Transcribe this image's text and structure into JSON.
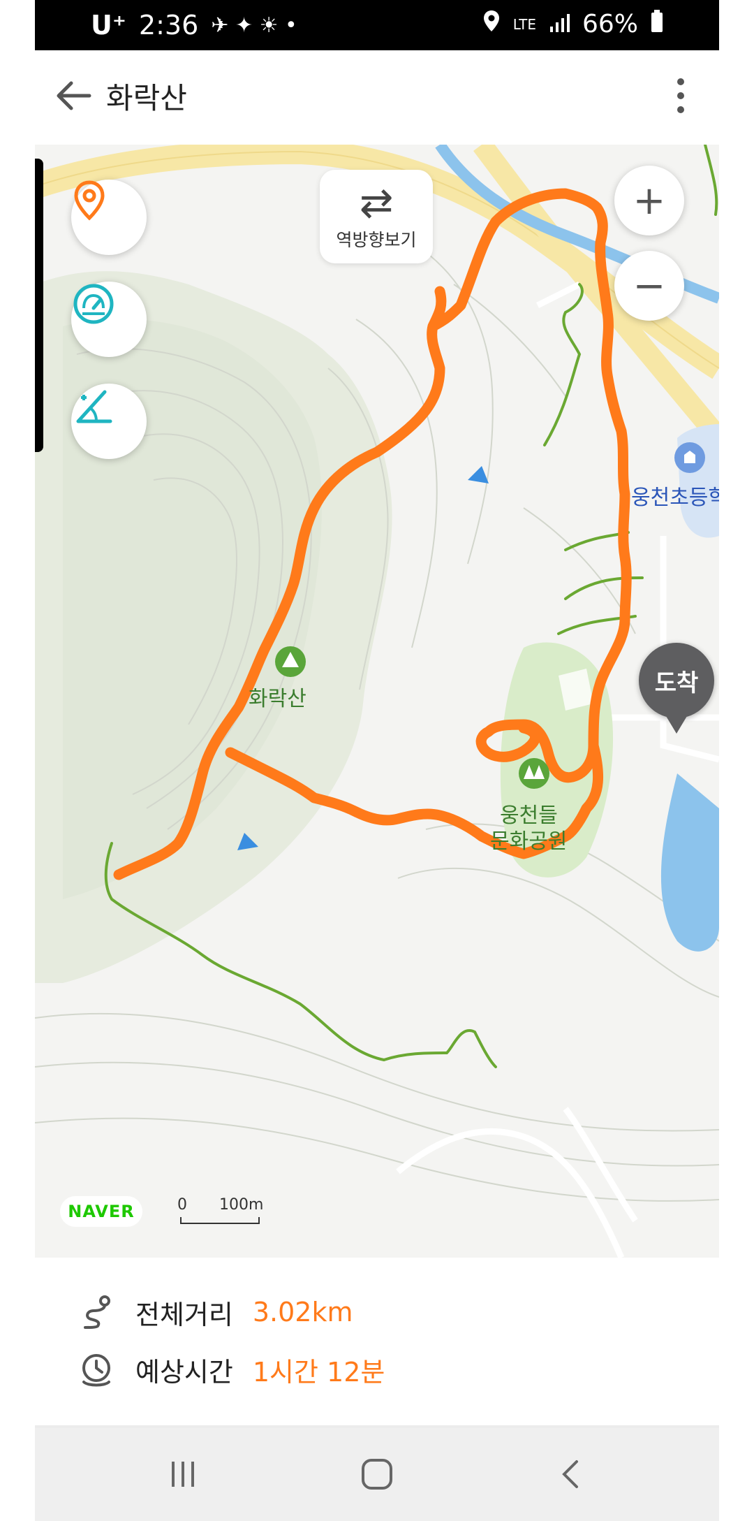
{
  "status_bar": {
    "carrier": "U⁺",
    "time": "2:36",
    "network": "LTE",
    "battery": "66%"
  },
  "app_bar": {
    "title": "화락산"
  },
  "map": {
    "reverse_label": "역방향보기",
    "labels": {
      "mountain": "화락산",
      "park_line1": "웅천들",
      "park_line2": "문화공원",
      "school": "웅천초등학"
    },
    "arrival_label": "도착",
    "naver": "NAVER",
    "scale_zero": "0",
    "scale_unit": "100m",
    "colors": {
      "route": "#ff7a1a",
      "trail": "#6aa832",
      "road": "#f7e7a6",
      "river": "#8cc3ec",
      "hill": "#e5ebdf",
      "park": "#d9ecc9"
    }
  },
  "summary": {
    "distance_label": "전체거리",
    "distance_value": "3.02km",
    "time_label": "예상시간",
    "time_value": "1시간 12분"
  }
}
